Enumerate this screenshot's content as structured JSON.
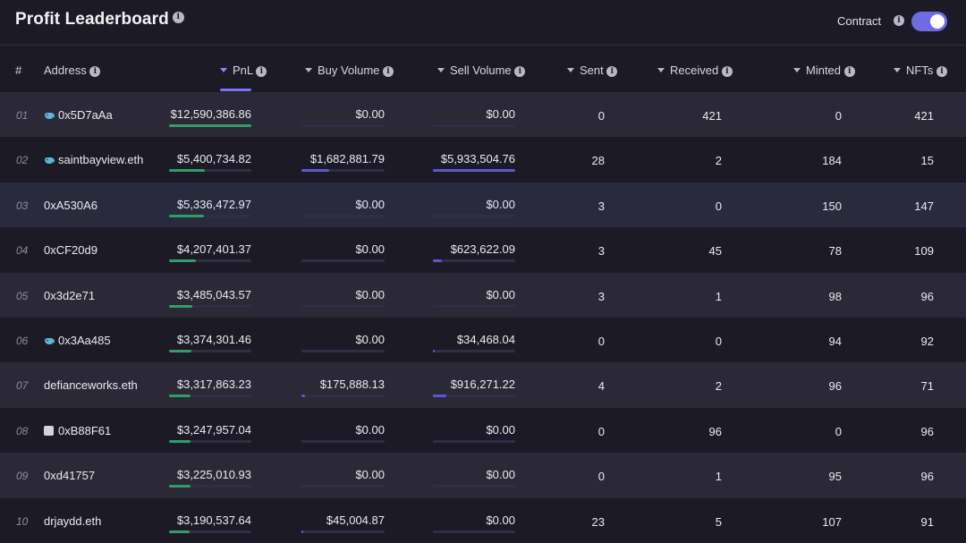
{
  "header": {
    "title": "Profit Leaderboard",
    "contract_label": "Contract",
    "contract_toggle_on": true
  },
  "colors": {
    "accent": "#6f6be3",
    "pnl_bar": "#2f9e6b",
    "volume_bar": "#5b57d6",
    "bar_track": "#2f2e45"
  },
  "columns": {
    "rank": "#",
    "address": "Address",
    "pnl": "PnL",
    "buy_volume": "Buy Volume",
    "sell_volume": "Sell Volume",
    "sent": "Sent",
    "received": "Received",
    "minted": "Minted",
    "nfts": "NFTs"
  },
  "rows": [
    {
      "rank": "01",
      "icon": "whale-icon",
      "address": "0x5D7aAa",
      "pnl": "$12,590,386.86",
      "pnl_frac": 1.0,
      "buy": "$0.00",
      "buy_frac": 0,
      "sell": "$0.00",
      "sell_frac": 0,
      "sent": "0",
      "received": "421",
      "minted": "0",
      "nfts": "421"
    },
    {
      "rank": "02",
      "icon": "whale-icon",
      "address": "saintbayview.eth",
      "pnl": "$5,400,734.82",
      "pnl_frac": 0.43,
      "buy": "$1,682,881.79",
      "buy_frac": 0.33,
      "sell": "$5,933,504.76",
      "sell_frac": 1.0,
      "sent": "28",
      "received": "2",
      "minted": "184",
      "nfts": "15"
    },
    {
      "rank": "03",
      "icon": "",
      "address": "0xA530A6",
      "pnl": "$5,336,472.97",
      "pnl_frac": 0.42,
      "buy": "$0.00",
      "buy_frac": 0,
      "sell": "$0.00",
      "sell_frac": 0,
      "sent": "3",
      "received": "0",
      "minted": "150",
      "nfts": "147"
    },
    {
      "rank": "04",
      "icon": "",
      "address": "0xCF20d9",
      "pnl": "$4,207,401.37",
      "pnl_frac": 0.33,
      "buy": "$0.00",
      "buy_frac": 0,
      "sell": "$623,622.09",
      "sell_frac": 0.11,
      "sent": "3",
      "received": "45",
      "minted": "78",
      "nfts": "109"
    },
    {
      "rank": "05",
      "icon": "",
      "address": "0x3d2e71",
      "pnl": "$3,485,043.57",
      "pnl_frac": 0.28,
      "buy": "$0.00",
      "buy_frac": 0,
      "sell": "$0.00",
      "sell_frac": 0,
      "sent": "3",
      "received": "1",
      "minted": "98",
      "nfts": "96"
    },
    {
      "rank": "06",
      "icon": "whale-icon",
      "address": "0x3Aa485",
      "pnl": "$3,374,301.46",
      "pnl_frac": 0.27,
      "buy": "$0.00",
      "buy_frac": 0,
      "sell": "$34,468.04",
      "sell_frac": 0.02,
      "sent": "0",
      "received": "0",
      "minted": "94",
      "nfts": "92"
    },
    {
      "rank": "07",
      "icon": "",
      "address": "defianceworks.eth",
      "pnl": "$3,317,863.23",
      "pnl_frac": 0.26,
      "buy": "$175,888.13",
      "buy_frac": 0.04,
      "sell": "$916,271.22",
      "sell_frac": 0.16,
      "sent": "4",
      "received": "2",
      "minted": "96",
      "nfts": "71"
    },
    {
      "rank": "08",
      "icon": "contract-icon",
      "address": "0xB88F61",
      "pnl": "$3,247,957.04",
      "pnl_frac": 0.26,
      "buy": "$0.00",
      "buy_frac": 0,
      "sell": "$0.00",
      "sell_frac": 0,
      "sent": "0",
      "received": "96",
      "minted": "0",
      "nfts": "96"
    },
    {
      "rank": "09",
      "icon": "",
      "address": "0xd41757",
      "pnl": "$3,225,010.93",
      "pnl_frac": 0.26,
      "buy": "$0.00",
      "buy_frac": 0,
      "sell": "$0.00",
      "sell_frac": 0,
      "sent": "0",
      "received": "1",
      "minted": "95",
      "nfts": "96"
    },
    {
      "rank": "10",
      "icon": "",
      "address": "drjaydd.eth",
      "pnl": "$3,190,537.64",
      "pnl_frac": 0.25,
      "buy": "$45,004.87",
      "buy_frac": 0.02,
      "sell": "$0.00",
      "sell_frac": 0,
      "sent": "23",
      "received": "5",
      "minted": "107",
      "nfts": "91"
    }
  ]
}
